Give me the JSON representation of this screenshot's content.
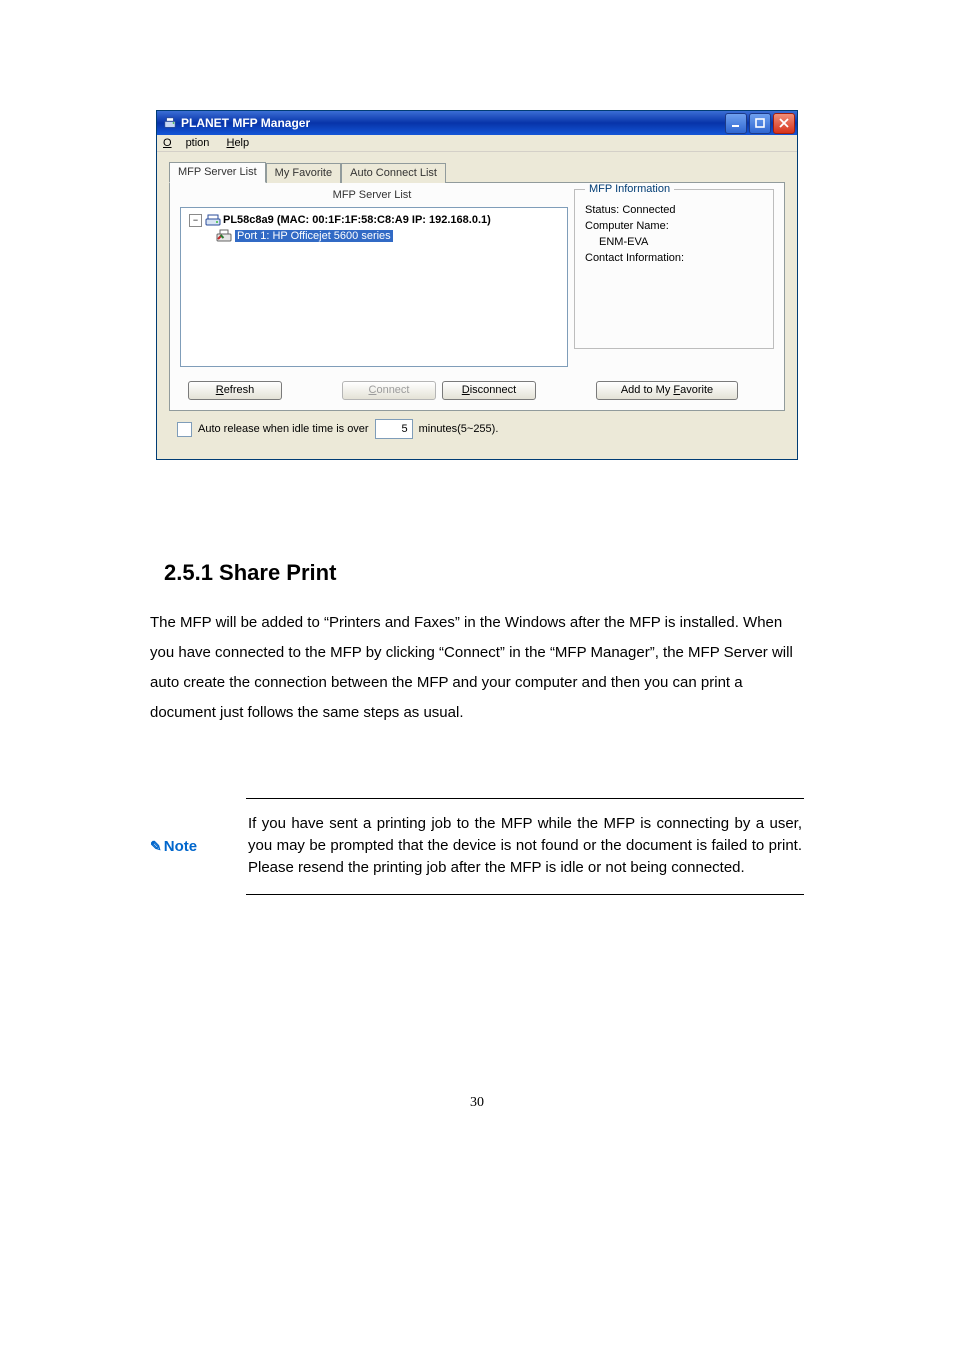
{
  "app": {
    "title": "PLANET MFP Manager",
    "menu": {
      "option": "Option",
      "help": "Help"
    },
    "tabs": {
      "server_list": "MFP Server List",
      "my_favorite": "My Favorite",
      "auto_connect": "Auto Connect List"
    },
    "tree": {
      "header": "MFP Server List",
      "root": "PL58c8a9 (MAC: 00:1F:1F:58:C8:A9  IP: 192.168.0.1)",
      "child": "Port 1: HP Officejet 5600 series"
    },
    "info": {
      "legend": "MFP Information",
      "status_label": "Status:",
      "status_value": "Connected",
      "computer_label": "Computer Name:",
      "computer_value": "ENM-EVA",
      "contact_label": "Contact Information:"
    },
    "buttons": {
      "refresh": "Refresh",
      "connect": "Connect",
      "disconnect": "Disconnect",
      "add_fav": "Add to My Favorite"
    },
    "footer": {
      "auto_release_label": "Auto release when idle time is over",
      "minutes_value": "5",
      "minutes_suffix": "minutes(5~255)."
    }
  },
  "doc": {
    "heading": "2.5.1 Share Print",
    "para": "The MFP will be added to “Printers and Faxes” in the Windows after the MFP is installed. When you have connected to the MFP by clicking “Connect” in the “MFP Manager”, the MFP Server will auto create the connection between the MFP and your computer and then you can print a document just follows the same steps as usual.",
    "note_label": "Note",
    "note_body": "If you have sent a printing job to the MFP while the MFP is connecting by a user, you may be prompted that the device is not found or the document is failed to print. Please resend the printing job after the MFP is idle or not being connected.",
    "page_number": "30"
  }
}
